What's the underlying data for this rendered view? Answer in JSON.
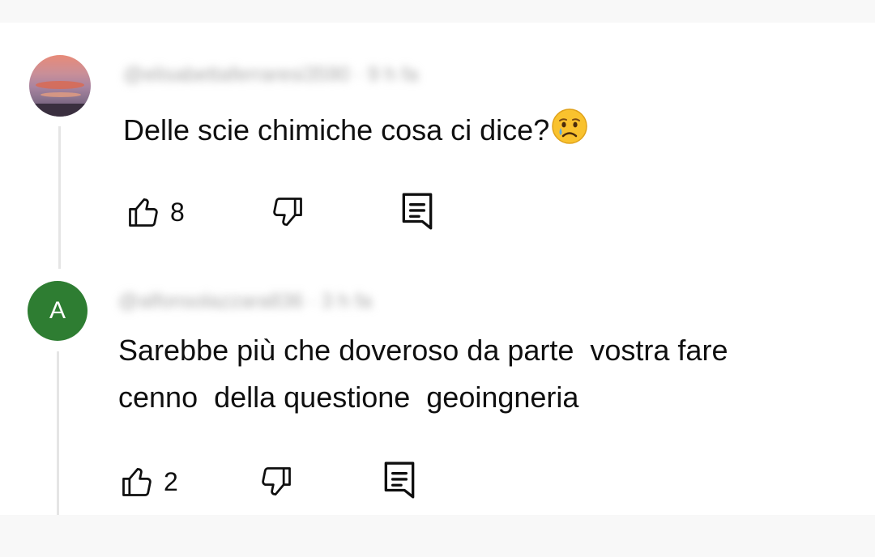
{
  "comments": [
    {
      "handle": "@elisabettaferraresi3590 · 9 h fa",
      "text": "Delle scie chimiche cosa ci dice?",
      "emoji": "crying-face-emoji",
      "likes": "8"
    },
    {
      "avatar_letter": "A",
      "avatar_color": "#2e7d32",
      "handle": "@alfonsolazzara836 · 3 h fa",
      "text_line1": "Sarebbe più che doveroso da parte  vostra fare",
      "text_line2": "cenno  della questione  geoingneria",
      "likes": "2"
    }
  ],
  "icons": {
    "like": "thumbs-up-icon",
    "dislike": "thumbs-down-icon",
    "reply": "reply-comment-icon"
  }
}
